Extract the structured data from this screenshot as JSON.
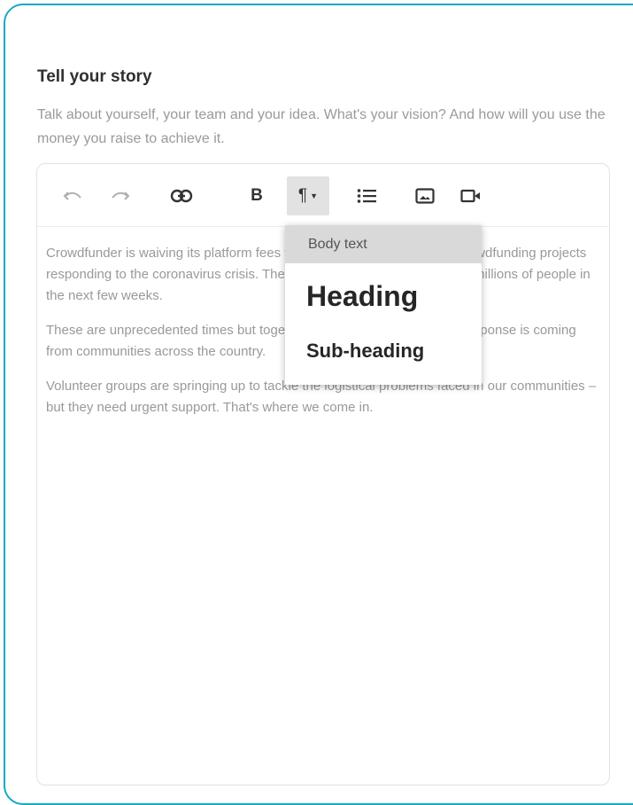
{
  "section": {
    "title": "Tell your story",
    "description": "Talk about yourself, your team and your idea. What's your vision? And how will you use the money you raise to achieve it."
  },
  "toolbar": {
    "items": [
      {
        "icon": "undo-icon"
      },
      {
        "icon": "redo-icon"
      },
      {
        "icon": "link-icon"
      },
      {
        "icon": "bold-icon",
        "label": "B"
      },
      {
        "icon": "paragraph-format-icon",
        "label": "¶"
      },
      {
        "icon": "bullet-list-icon"
      },
      {
        "icon": "image-icon"
      },
      {
        "icon": "video-icon"
      }
    ]
  },
  "content": {
    "paragraphs": [
      "Crowdfunder is waiving its platform fees for all community and charity crowdfunding projects responding to the coronavirus crisis. The Covid-19 epidemic could affect millions of people in the next few weeks.",
      "These are unprecedented times but together, we are stronger, and the response is coming from communities across the country.",
      "Volunteer groups are springing up to tackle the logistical problems faced in our communities – but they need urgent support. That's where we come in."
    ]
  },
  "format_menu": {
    "options": [
      "Body text",
      "Heading",
      "Sub-heading"
    ],
    "selected": "Body text"
  },
  "colors": {
    "accent_border": "#16a9c4",
    "body_text": "#999999"
  }
}
